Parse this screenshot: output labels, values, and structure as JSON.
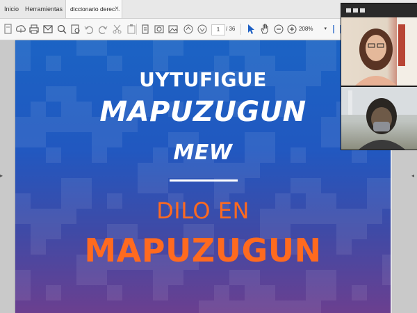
{
  "tabs": {
    "home": "Inicio",
    "tools": "Herramientas",
    "document": "diccionario derec...",
    "close": "×"
  },
  "toolbar": {
    "current_page": "1",
    "total_pages": "/ 36",
    "zoom": "208%",
    "icons": [
      "create-icon",
      "upload-icon",
      "print-icon",
      "mail-icon",
      "search-icon",
      "print-preview-icon",
      "undo-icon",
      "redo-icon",
      "cut-icon",
      "clipboard-icon",
      "copy-icon",
      "camera-icon",
      "image-icon",
      "page-up-icon",
      "page-down-icon",
      "cursor-icon",
      "hand-icon",
      "zoom-out-icon",
      "zoom-in-icon",
      "fit-icon"
    ]
  },
  "document": {
    "line1": "UYTUFIGUE",
    "line2": "MAPUZUGUN",
    "line3": "MEW",
    "line4": "DILO EN",
    "line5": "MAPUZUGUN",
    "colors": {
      "top": "#1b63c4",
      "bottom": "#6b3f8f",
      "accent": "#ff6a1f",
      "white": "#ffffff"
    }
  },
  "video_call": {
    "participants": [
      "participant-1",
      "participant-2"
    ]
  }
}
